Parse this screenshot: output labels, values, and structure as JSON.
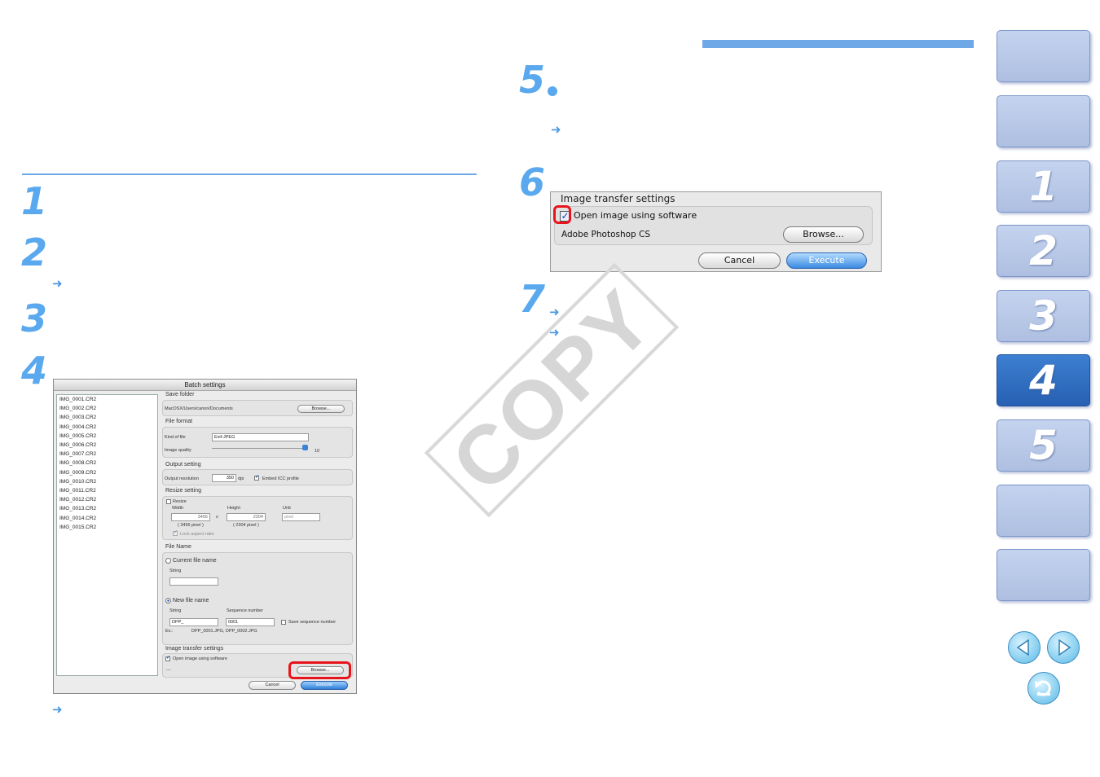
{
  "steps_left": [
    "1",
    "2",
    "3",
    "4"
  ],
  "steps_right": [
    "5",
    "6",
    "7"
  ],
  "batch_dialog": {
    "title": "Batch settings",
    "files": [
      "IMG_0001.CR2",
      "IMG_0002.CR2",
      "IMG_0003.CR2",
      "IMG_0004.CR2",
      "IMG_0005.CR2",
      "IMG_0006.CR2",
      "IMG_0007.CR2",
      "IMG_0008.CR2",
      "IMG_0009.CR2",
      "IMG_0010.CR2",
      "IMG_0011.CR2",
      "IMG_0012.CR2",
      "IMG_0013.CR2",
      "IMG_0014.CR2",
      "IMG_0015.CR2"
    ],
    "save_folder_label": "Save folder",
    "save_folder_path": "MacOSX/Users/canon/Documents",
    "browse_label": "Browse...",
    "file_format_label": "File format",
    "kind_of_file_label": "Kind of file",
    "kind_of_file_value": "Exif-JPEG",
    "image_quality_label": "Image quality",
    "image_quality_value": "10",
    "output_setting_label": "Output setting",
    "output_resolution_label": "Output resolution",
    "output_resolution_value": "350",
    "dpi_label": "dpi",
    "embed_icc_label": "Embed ICC profile",
    "resize_setting_label": "Resize setting",
    "resize_label": "Resize",
    "width_label": "Width",
    "height_label": "Height",
    "unit_label": "Unit",
    "width_value": "3456",
    "height_value": "2304",
    "x_label": "x",
    "unit_value": "pixel",
    "width_pixel_note": "( 3456 pixel )",
    "height_pixel_note": "( 2304 pixel )",
    "lock_aspect_label": "Lock aspect ratio",
    "file_name_label": "File Name",
    "current_file_name_label": "Current file name",
    "string_label": "String",
    "new_file_name_label": "New file name",
    "sequence_number_label": "Sequence number",
    "string_value": "DPP_",
    "sequence_value": "0001",
    "save_sequence_label": "Save sequence number",
    "example_label": "Ex.:",
    "example_value": "DPP_0001.JPG, DPP_0002.JPG",
    "image_transfer_label": "Image transfer settings",
    "open_image_label": "Open image using software",
    "software_value": "---",
    "cancel_label": "Cancel",
    "execute_label": "Execute"
  },
  "transfer_dialog": {
    "title": "Image transfer settings",
    "open_image_label": "Open image using software",
    "software_value": "Adobe Photoshop CS",
    "browse_label": "Browse...",
    "cancel_label": "Cancel",
    "execute_label": "Execute"
  },
  "watermark": "COPY",
  "side_tabs": [
    "",
    "",
    "1",
    "2",
    "3",
    "4",
    "5",
    "",
    ""
  ],
  "active_tab": "4",
  "colors": {
    "accent": "#5aa8ee",
    "tab": "#b8c8e8",
    "tab_active": "#2f6ec0",
    "highlight": "#e8141c"
  }
}
